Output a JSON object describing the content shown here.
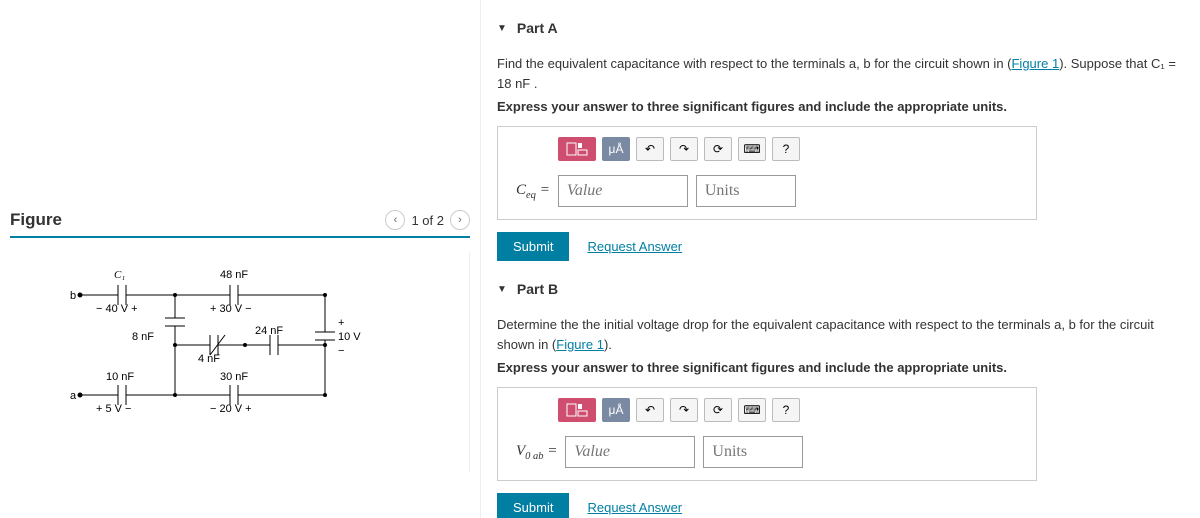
{
  "figure": {
    "heading": "Figure",
    "pager": {
      "label": "1 of 2"
    },
    "circuit": {
      "terminal_b": "b",
      "terminal_a": "a",
      "C1_label": "C₁",
      "C1_volt": "− 40 V +",
      "C48": "48 nF",
      "C48_volt": "+ 30 V −",
      "C8": "8 nF",
      "C4": "4 nF",
      "C24": "24 nF",
      "V10": "10 V",
      "C10": "10 nF",
      "C10_volt": "+ 5 V −",
      "C30": "30 nF",
      "C30_volt": "− 20 V +"
    }
  },
  "partA": {
    "title": "Part A",
    "prompt_pre": "Find the equivalent capacitance with respect to the terminals a, b for the circuit shown in (",
    "prompt_link": "Figure 1",
    "prompt_post": "). Suppose that C₁ = 18 nF .",
    "instruction": "Express your answer to three significant figures and include the appropriate units.",
    "var_label": "Ceq =",
    "value_ph": "Value",
    "units_ph": "Units",
    "submit": "Submit",
    "request": "Request Answer"
  },
  "partB": {
    "title": "Part B",
    "prompt_pre": "Determine the the initial voltage drop for the equivalent capacitance with respect to the terminals a, b for the circuit shown in (",
    "prompt_link": "Figure 1",
    "prompt_post": ").",
    "instruction": "Express your answer to three significant figures and include the appropriate units.",
    "var_label": "V0 ab =",
    "value_ph": "Value",
    "units_ph": "Units",
    "submit": "Submit",
    "request": "Request Answer"
  },
  "toolbar": {
    "mu_label": "μÅ",
    "help": "?"
  }
}
